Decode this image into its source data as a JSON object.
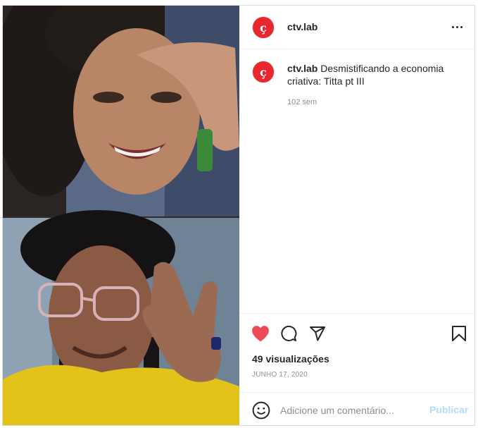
{
  "header": {
    "avatar_glyph": "ç",
    "username": "ctv.lab"
  },
  "caption": {
    "avatar_glyph": "ç",
    "username": "ctv.lab",
    "text": "Desmistificando a economia criativa: Titta pt III",
    "age": "102 sem"
  },
  "actions": {
    "like_icon": "heart-filled-icon",
    "comment_icon": "comment-icon",
    "share_icon": "paper-plane-icon",
    "save_icon": "bookmark-icon",
    "like_color": "#ed4956"
  },
  "stats": {
    "views": "49 visualizações",
    "date": "JUNHO 17, 2020"
  },
  "comment": {
    "placeholder": "Adicione um comentário...",
    "publish_label": "Publicar",
    "publish_color": "#b3dbff"
  }
}
